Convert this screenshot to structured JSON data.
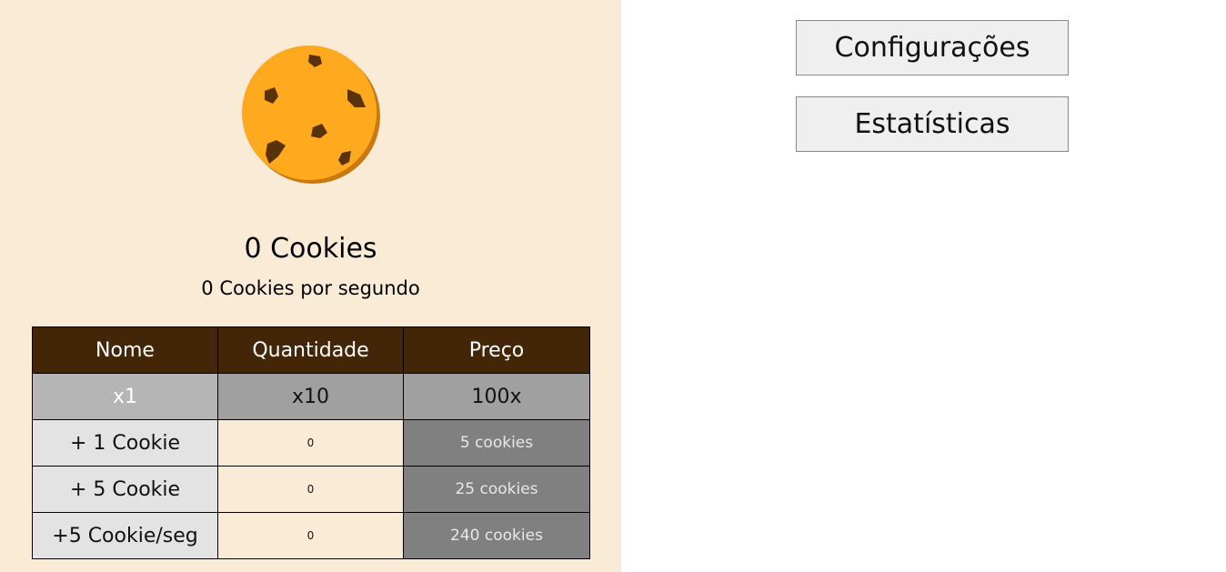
{
  "cookie": {
    "count_text": "0 Cookies",
    "rate_text": "0 Cookies por segundo",
    "colors": {
      "dough": "#ffa91f",
      "edge": "#c87a10",
      "chips": "#5a3209"
    }
  },
  "shop": {
    "headers": {
      "name": "Nome",
      "quantity": "Quantidade",
      "price": "Preço"
    },
    "multipliers": [
      "x1",
      "x10",
      "100x"
    ],
    "selected_multiplier": "x1",
    "items": [
      {
        "name": "+ 1 Cookie",
        "quantity": "0",
        "price": "5 cookies"
      },
      {
        "name": "+ 5 Cookie",
        "quantity": "0",
        "price": "25 cookies"
      },
      {
        "name": "+5 Cookie/seg",
        "quantity": "0",
        "price": "240 cookies"
      }
    ]
  },
  "menu": {
    "settings_label": "Configurações",
    "stats_label": "Estatísticas"
  }
}
